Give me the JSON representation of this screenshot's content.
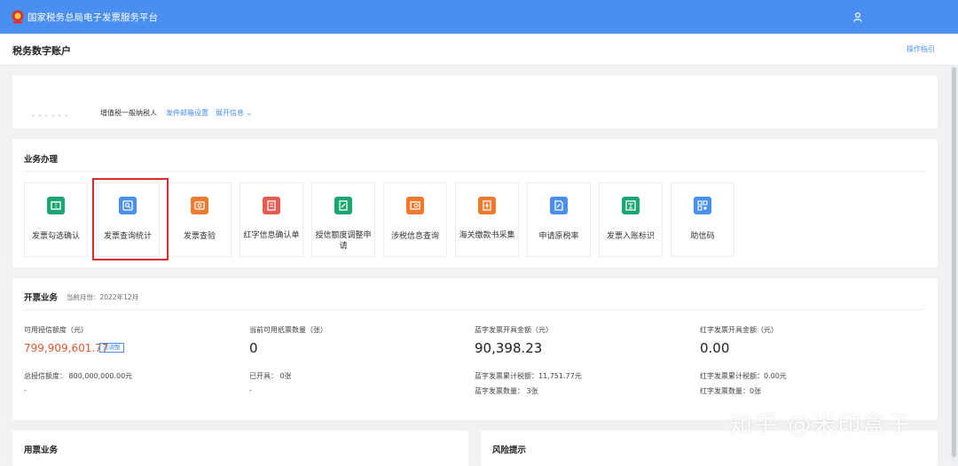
{
  "header": {
    "app_title": "国家税务总局电子发票服务平台"
  },
  "subheader": {
    "page_title": "税务数字账户",
    "guide_link": "操作指引"
  },
  "account": {
    "masked_name": "- - - - - -",
    "taxpayer_type": "增值税一般纳税人",
    "email_settings_link": "发件邮箱设置",
    "expand_info_link": "展开信息 ⌄"
  },
  "business": {
    "title": "业务办理",
    "tiles": [
      {
        "label": "发票勾选确认",
        "icon": "ticket-icon",
        "color": "#1aa571"
      },
      {
        "label": "发票查询统计",
        "icon": "search-doc-icon",
        "color": "#4a8ef0"
      },
      {
        "label": "发票查验",
        "icon": "invoice-check-icon",
        "color": "#ef7a2d"
      },
      {
        "label": "红字信息确认单",
        "icon": "red-doc-icon",
        "color": "#e55b52"
      },
      {
        "label": "授信额度调整申请",
        "icon": "credit-edit-icon",
        "color": "#1aa571"
      },
      {
        "label": "涉税信息查询",
        "icon": "tax-search-icon",
        "color": "#ef7a2d"
      },
      {
        "label": "海关缴款书采集",
        "icon": "customs-icon",
        "color": "#ef7a2d"
      },
      {
        "label": "申请原税率",
        "icon": "apply-rate-icon",
        "color": "#4a8ef0"
      },
      {
        "label": "发票入账标识",
        "icon": "ledger-mark-icon",
        "color": "#1aa571"
      },
      {
        "label": "助信码",
        "icon": "qr-code-icon",
        "color": "#4a8ef0"
      }
    ]
  },
  "issuance": {
    "title": "开票业务",
    "current_month": "当前月份：2022年12月",
    "credit_available_label": "可用授信额度（元）",
    "credit_available_value": "799,909,601.77",
    "adjust_badge": "去调整",
    "credit_total": "总授信额度： 800,000,000.00元",
    "credit_dash": "-",
    "paper_available_label": "当前可用纸票数量（张）",
    "paper_available_value": "0",
    "paper_issued": "已开具： 0张",
    "paper_dash": "-",
    "blue_amount_label": "蓝字发票开具金额（元）",
    "blue_amount_value": "90,398.23",
    "blue_tax": "蓝字发票累计税额：11,751.77元",
    "blue_count": "蓝字发票数量： 3张",
    "red_amount_label": "红字发票开具金额（元）",
    "red_amount_value": "0.00",
    "red_tax": "红字发票累计税额：0.00元",
    "red_count": "红字发票数量：0张"
  },
  "usage": {
    "title": "用票业务"
  },
  "risk": {
    "title": "风险提示"
  },
  "watermark": "知乎 @米印盒子"
}
